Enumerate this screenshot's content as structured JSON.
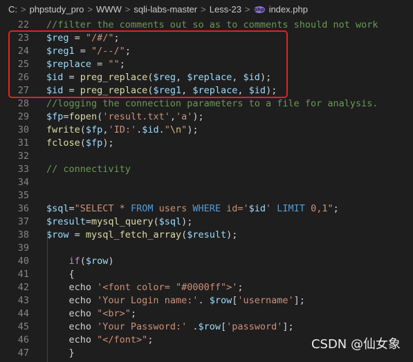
{
  "breadcrumb": [
    "C:",
    "phpstudy_pro",
    "WWW",
    "sqli-labs-master",
    "Less-23",
    "index.php"
  ],
  "breadcrumb_sep": ">",
  "file_icon": "php-file-icon",
  "colors": {
    "background": "#1e1e1e",
    "comment": "#6a9955",
    "variable": "#9cdcfe",
    "string": "#ce9178",
    "function": "#dcdcaa",
    "keyword": "#c586c0",
    "highlight_box": "#e8211b"
  },
  "lines": [
    {
      "n": "22",
      "t": [
        [
          "c",
          "//filter the comments out so as to comments should not work"
        ]
      ]
    },
    {
      "n": "23",
      "t": [
        [
          "v",
          "$reg"
        ],
        [
          "p",
          " = "
        ],
        [
          "s",
          "\"/#/\""
        ],
        [
          "p",
          ";"
        ]
      ]
    },
    {
      "n": "24",
      "t": [
        [
          "v",
          "$reg1"
        ],
        [
          "p",
          " = "
        ],
        [
          "s",
          "\"/--/\""
        ],
        [
          "p",
          ";"
        ]
      ]
    },
    {
      "n": "25",
      "t": [
        [
          "v",
          "$replace"
        ],
        [
          "p",
          " = "
        ],
        [
          "s",
          "\"\""
        ],
        [
          "p",
          ";"
        ]
      ]
    },
    {
      "n": "26",
      "t": [
        [
          "v",
          "$id"
        ],
        [
          "p",
          " = "
        ],
        [
          "f",
          "preg_replace"
        ],
        [
          "p",
          "("
        ],
        [
          "v",
          "$reg"
        ],
        [
          "p",
          ", "
        ],
        [
          "v",
          "$replace"
        ],
        [
          "p",
          ", "
        ],
        [
          "v",
          "$id"
        ],
        [
          "p",
          ");"
        ]
      ]
    },
    {
      "n": "27",
      "t": [
        [
          "v",
          "$id"
        ],
        [
          "p",
          " = "
        ],
        [
          "f",
          "preg_replace"
        ],
        [
          "p",
          "("
        ],
        [
          "v",
          "$reg1"
        ],
        [
          "p",
          ", "
        ],
        [
          "v",
          "$replace"
        ],
        [
          "p",
          ", "
        ],
        [
          "v",
          "$id"
        ],
        [
          "p",
          ");"
        ]
      ]
    },
    {
      "n": "28",
      "t": [
        [
          "c",
          "//logging the connection parameters to a file for analysis."
        ]
      ]
    },
    {
      "n": "29",
      "t": [
        [
          "v",
          "$fp"
        ],
        [
          "p",
          "="
        ],
        [
          "f",
          "fopen"
        ],
        [
          "p",
          "("
        ],
        [
          "s",
          "'result.txt'"
        ],
        [
          "p",
          ","
        ],
        [
          "s",
          "'a'"
        ],
        [
          "p",
          ");"
        ]
      ]
    },
    {
      "n": "30",
      "t": [
        [
          "f",
          "fwrite"
        ],
        [
          "p",
          "("
        ],
        [
          "v",
          "$fp"
        ],
        [
          "p",
          ","
        ],
        [
          "s",
          "'ID:'"
        ],
        [
          "p",
          "."
        ],
        [
          "v",
          "$id"
        ],
        [
          "p",
          "."
        ],
        [
          "s",
          "\""
        ],
        [
          "e",
          "\\n"
        ],
        [
          "s",
          "\""
        ],
        [
          "p",
          ");"
        ]
      ]
    },
    {
      "n": "31",
      "t": [
        [
          "f",
          "fclose"
        ],
        [
          "p",
          "("
        ],
        [
          "v",
          "$fp"
        ],
        [
          "p",
          ");"
        ]
      ]
    },
    {
      "n": "32",
      "t": []
    },
    {
      "n": "33",
      "t": [
        [
          "c",
          "// connectivity"
        ]
      ]
    },
    {
      "n": "34",
      "t": []
    },
    {
      "n": "35",
      "t": []
    },
    {
      "n": "36",
      "t": [
        [
          "v",
          "$sql"
        ],
        [
          "p",
          "="
        ],
        [
          "s",
          "\"SELECT * "
        ],
        [
          "k2",
          "FROM"
        ],
        [
          "s",
          " users "
        ],
        [
          "k2",
          "WHERE"
        ],
        [
          "s",
          " id='"
        ],
        [
          "v",
          "$id"
        ],
        [
          "s",
          "' "
        ],
        [
          "k2",
          "LIMIT"
        ],
        [
          "s",
          " 0,1\""
        ],
        [
          "p",
          ";"
        ]
      ]
    },
    {
      "n": "37",
      "t": [
        [
          "v",
          "$result"
        ],
        [
          "p",
          "="
        ],
        [
          "f",
          "mysql_query"
        ],
        [
          "p",
          "("
        ],
        [
          "v",
          "$sql"
        ],
        [
          "p",
          ");"
        ]
      ]
    },
    {
      "n": "38",
      "t": [
        [
          "v",
          "$row"
        ],
        [
          "p",
          " = "
        ],
        [
          "f",
          "mysql_fetch_array"
        ],
        [
          "p",
          "("
        ],
        [
          "v",
          "$result"
        ],
        [
          "p",
          ");"
        ]
      ]
    },
    {
      "n": "39",
      "t": []
    },
    {
      "n": "40",
      "t": [
        [
          "p",
          "    "
        ],
        [
          "k",
          "if"
        ],
        [
          "p",
          "("
        ],
        [
          "v",
          "$row"
        ],
        [
          "p",
          ")"
        ]
      ]
    },
    {
      "n": "41",
      "t": [
        [
          "p",
          "    {"
        ]
      ]
    },
    {
      "n": "42",
      "t": [
        [
          "p",
          "    echo "
        ],
        [
          "s",
          "'<font color= \"#0000ff\">'"
        ],
        [
          "p",
          ";"
        ]
      ]
    },
    {
      "n": "43",
      "t": [
        [
          "p",
          "    echo "
        ],
        [
          "s",
          "'Your Login name:'"
        ],
        [
          "p",
          ". "
        ],
        [
          "v",
          "$row"
        ],
        [
          "p",
          "["
        ],
        [
          "s",
          "'username'"
        ],
        [
          "p",
          "];"
        ]
      ]
    },
    {
      "n": "44",
      "t": [
        [
          "p",
          "    echo "
        ],
        [
          "s",
          "\"<br>\""
        ],
        [
          "p",
          ";"
        ]
      ]
    },
    {
      "n": "45",
      "t": [
        [
          "p",
          "    echo "
        ],
        [
          "s",
          "'Your Password:'"
        ],
        [
          "p",
          " ."
        ],
        [
          "v",
          "$row"
        ],
        [
          "p",
          "["
        ],
        [
          "s",
          "'password'"
        ],
        [
          "p",
          "];"
        ]
      ]
    },
    {
      "n": "46",
      "t": [
        [
          "p",
          "    echo "
        ],
        [
          "s",
          "\"</font>\""
        ],
        [
          "p",
          ";"
        ]
      ]
    },
    {
      "n": "47",
      "t": [
        [
          "p",
          "    }"
        ]
      ]
    }
  ],
  "watermark": "CSDN @仙女象"
}
